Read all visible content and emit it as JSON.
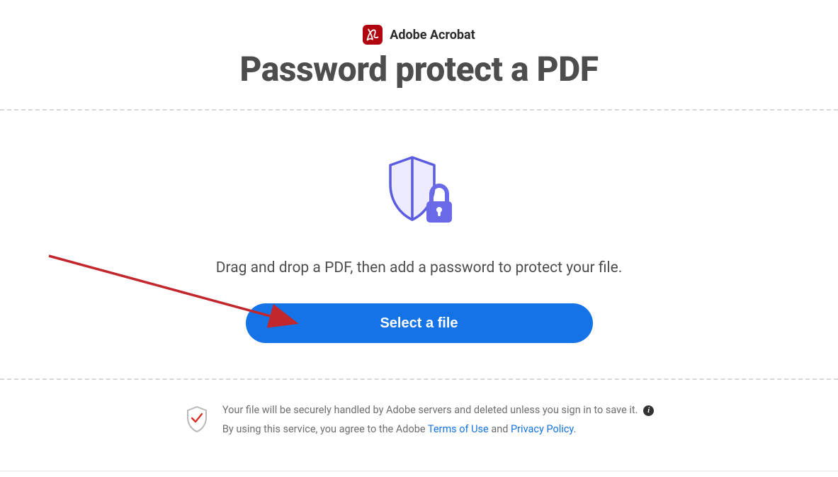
{
  "header": {
    "brand_label": "Adobe Acrobat",
    "page_title": "Password protect a PDF"
  },
  "main": {
    "instructions": "Drag and drop a PDF, then add a password to protect your file.",
    "select_button_label": "Select a file"
  },
  "footer": {
    "line1": "Your file will be securely handled by Adobe servers and deleted unless you sign in to save it.",
    "line2_prefix": "By using this service, you agree to the Adobe ",
    "terms_link": "Terms of Use",
    "and": " and ",
    "privacy_link": "Privacy Policy",
    "period": "."
  }
}
